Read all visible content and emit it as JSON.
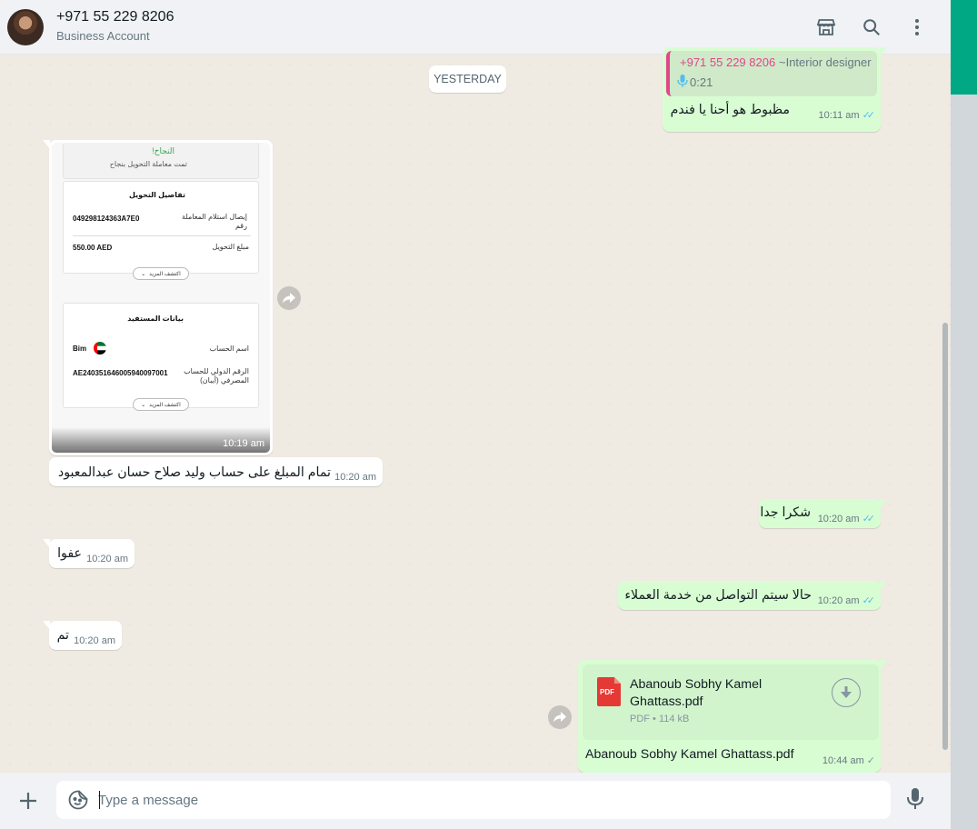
{
  "header": {
    "contact_name": "+971 55 229 8206",
    "contact_subtitle": "Business Account"
  },
  "chat": {
    "date_separator": "YESTERDAY",
    "messages": [
      {
        "quote_sender": "+971 55 229 8206",
        "quote_note": "~Interior designer",
        "quote_duration": "0:21",
        "text": "مظبوط هو أحنا يا فندم",
        "time": "10:11 am"
      },
      {
        "image_time": "10:19 am"
      },
      {
        "text": "تمام المبلغ على حساب وليد صلاح حسان عبدالمعبود",
        "time": "10:20 am"
      },
      {
        "text": "شكرا جدا",
        "time": "10:20 am"
      },
      {
        "text": "عفوا",
        "time": "10:20 am"
      },
      {
        "text": "حالا سيتم التواصل من خدمة العملاء",
        "time": "10:20 am"
      },
      {
        "text": "تم",
        "time": "10:20 am"
      },
      {
        "doc_name_line1": "Abanoub Sobhy Kamel",
        "doc_name_line2": "Ghattass.pdf",
        "doc_meta": "PDF • 114 kB",
        "doc_badge": "PDF",
        "caption": "Abanoub Sobhy Kamel Ghattass.pdf",
        "time": "10:44 am"
      }
    ]
  },
  "receipt": {
    "success_title": "النجاح!",
    "success_sub": "تمت معاملة التحويل بنجاح",
    "details_title": "تفاصيل التحويل",
    "receipt_label": "إيصال استلام المعاملة رقم",
    "receipt_number": "049298124363A7E0",
    "amount_label": "مبلغ التحويل",
    "amount_value": "550.00 AED",
    "more_label": "اكتشف المزيد",
    "beneficiary_title": "بيانات المستفيد",
    "account_name_label": "اسم الحساب",
    "account_name_value": "Bim",
    "iban_label": "الرقم الدولي للحساب المصرفي (أيبان)",
    "iban_value": "AE240351646005940097001"
  },
  "composer": {
    "placeholder": "Type a message"
  },
  "colors": {
    "accent": "#00a884",
    "outgoing_bubble": "#d9fdd3",
    "incoming_bubble": "#ffffff",
    "read_ticks": "#53bdeb",
    "quote_sender": "#e2468a"
  },
  "icons": [
    "store-icon",
    "search-icon",
    "more-vertical-icon",
    "forward-icon",
    "download-icon",
    "pdf-icon",
    "plus-icon",
    "sticker-icon",
    "mic-icon"
  ]
}
